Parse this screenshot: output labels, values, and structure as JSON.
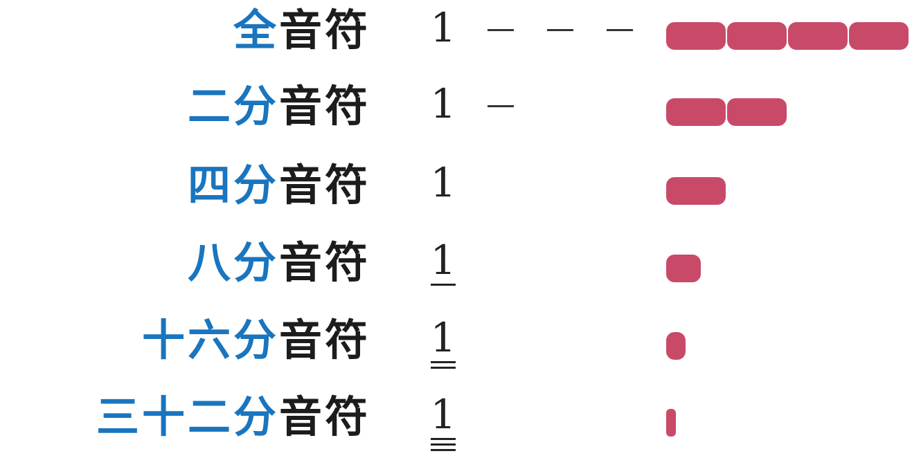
{
  "rows": [
    {
      "blue": "全",
      "black": "音符",
      "digit": "1",
      "dashes": 3,
      "underlines": 0,
      "duration": 4
    },
    {
      "blue": "二分",
      "black": "音符",
      "digit": "1",
      "dashes": 1,
      "underlines": 0,
      "duration": 2
    },
    {
      "blue": "四分",
      "black": "音符",
      "digit": "1",
      "dashes": 0,
      "underlines": 0,
      "duration": 1
    },
    {
      "blue": "八分",
      "black": "音符",
      "digit": "1",
      "dashes": 0,
      "underlines": 1,
      "duration": 0.5
    },
    {
      "blue": "十六分",
      "black": "音符",
      "digit": "1",
      "dashes": 0,
      "underlines": 2,
      "duration": 0.25
    },
    {
      "blue": "三十二分",
      "black": "音符",
      "digit": "1",
      "dashes": 0,
      "underlines": 3,
      "duration": 0.125
    }
  ],
  "colors": {
    "blue": "#1a75bf",
    "black": "#1c1c1c",
    "bar": "#c94a68"
  }
}
